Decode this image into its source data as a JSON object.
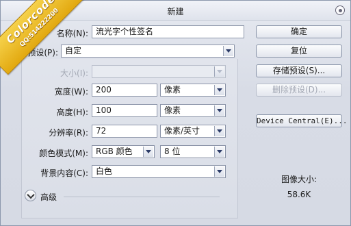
{
  "window": {
    "title": "新建"
  },
  "watermark": {
    "line1": "Colorcode",
    "line2": "QQ:514222200"
  },
  "form": {
    "name": {
      "label": "名称(N):",
      "value": "流光字个性签名"
    },
    "preset": {
      "label": "预设(P):",
      "value": "自定"
    },
    "size": {
      "label": "大小(I):",
      "value": ""
    },
    "width": {
      "label": "宽度(W):",
      "value": "200",
      "unit": "像素"
    },
    "height": {
      "label": "高度(H):",
      "value": "100",
      "unit": "像素"
    },
    "resolution": {
      "label": "分辨率(R):",
      "value": "72",
      "unit": "像素/英寸"
    },
    "color_mode": {
      "label": "颜色模式(M):",
      "value": "RGB 颜色",
      "depth": "8 位"
    },
    "background": {
      "label": "背景内容(C):",
      "value": "白色"
    },
    "advanced": {
      "label": "高级"
    }
  },
  "buttons": {
    "ok": "确定",
    "reset": "复位",
    "save_preset": "存储预设(S)...",
    "delete_preset": "删除预设(D)...",
    "device_central": "Device Central(E)..."
  },
  "image_size": {
    "label": "图像大小:",
    "value": "58.6K"
  }
}
